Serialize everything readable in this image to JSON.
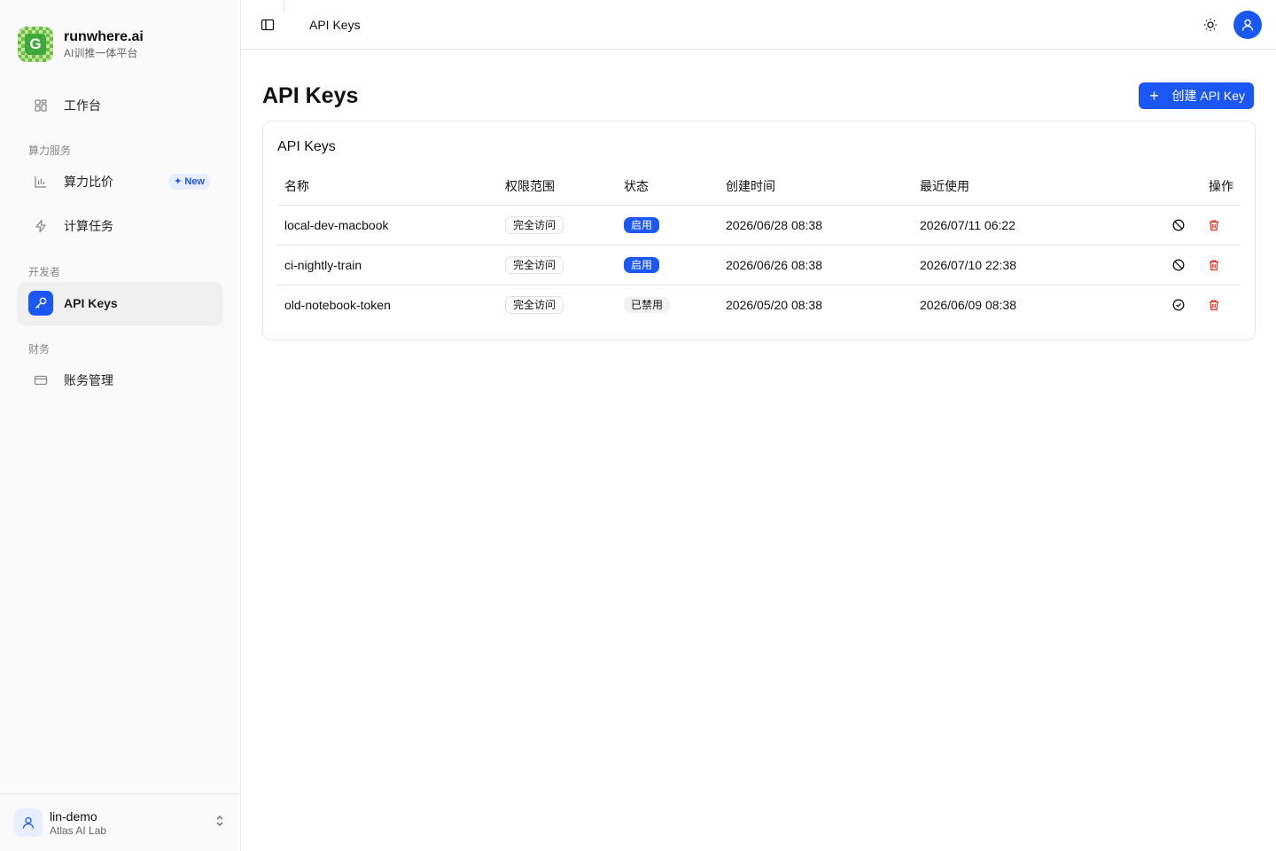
{
  "brand": {
    "name": "runwhere.ai",
    "subtitle": "AI训推一体平台",
    "logo_letter": "G"
  },
  "sidebar": {
    "items": [
      {
        "label": "工作台",
        "icon": "dashboard-icon"
      },
      {
        "section": "算力服务"
      },
      {
        "label": "算力比价",
        "icon": "bar-chart-icon",
        "badge": "New"
      },
      {
        "label": "计算任务",
        "icon": "zap-icon"
      },
      {
        "section": "开发者"
      },
      {
        "label": "API Keys",
        "icon": "key-icon",
        "active": true
      },
      {
        "section": "财务"
      },
      {
        "label": "账务管理",
        "icon": "credit-card-icon"
      }
    ],
    "labels": {
      "workbench": "工作台",
      "compute_section": "算力服务",
      "price_compare": "算力比价",
      "new_badge": "New",
      "compute_jobs": "计算任务",
      "dev_section": "开发者",
      "api_keys": "API Keys",
      "finance_section": "财务",
      "billing": "账务管理"
    },
    "user": {
      "name": "lin-demo",
      "org": "Atlas AI Lab"
    }
  },
  "topbar": {
    "title": "API Keys"
  },
  "page": {
    "title": "API Keys",
    "create_button": "创建 API Key"
  },
  "card": {
    "title": "API Keys"
  },
  "table": {
    "headers": {
      "name": "名称",
      "scope": "权限范围",
      "status": "状态",
      "created": "创建时间",
      "last_used": "最近使用",
      "actions": "操作"
    },
    "rows": [
      {
        "name": "local-dev-macbook",
        "scope": "完全访问",
        "status": "启用",
        "created": "2026/06/28 08:38",
        "last_used": "2026/07/11 06:22"
      },
      {
        "name": "ci-nightly-train",
        "scope": "完全访问",
        "status": "启用",
        "created": "2026/06/26 08:38",
        "last_used": "2026/07/10 22:38"
      },
      {
        "name": "old-notebook-token",
        "scope": "完全访问",
        "status": "已禁用",
        "created": "2026/05/20 08:38",
        "last_used": "2026/06/09 08:38"
      }
    ]
  },
  "colors": {
    "accent": "#1b57f5",
    "danger": "#e0342b",
    "logo_green": "#6fbf3b"
  }
}
